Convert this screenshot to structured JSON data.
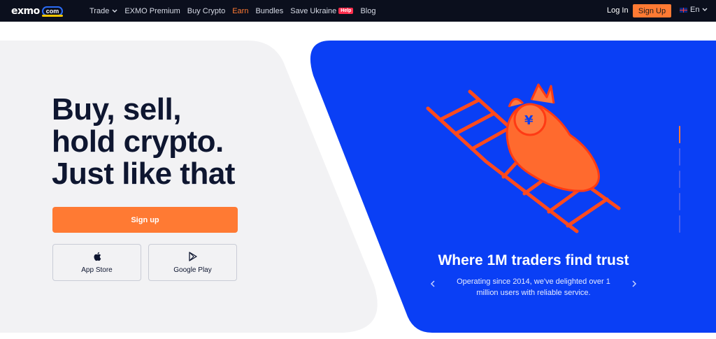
{
  "nav": {
    "logo_text": "exmo",
    "logo_badge": "com",
    "links": [
      {
        "label": "Trade",
        "has_dropdown": true
      },
      {
        "label": "EXMO Premium"
      },
      {
        "label": "Buy Crypto"
      },
      {
        "label": "Earn",
        "highlight": true
      },
      {
        "label": "Bundles"
      },
      {
        "label": "Save Ukraine",
        "badge": "Help"
      },
      {
        "label": "Blog"
      }
    ],
    "login": "Log In",
    "signup": "Sign Up",
    "language": "En"
  },
  "hero": {
    "headline": [
      "Buy, sell,",
      "hold crypto.",
      "Just like that"
    ],
    "signup_button": "Sign up",
    "app_store": {
      "label": "App Store",
      "icon": "apple-icon"
    },
    "google_play": {
      "label": "Google Play",
      "icon": "google-play-icon"
    }
  },
  "slider": {
    "title": "Where 1M traders find trust",
    "description": "Operating since 2014, we've delighted over 1 million users with reliable service.",
    "prev_icon": "chevron-left-icon",
    "next_icon": "chevron-right-icon",
    "indicator_count": 5,
    "active_index": 0
  },
  "colors": {
    "nav_bg": "#0b0f1d",
    "accent_orange": "#ff7a33",
    "hero_blue": "#0a3ff5",
    "left_panel": "#f2f2f4",
    "headline": "#0e1630"
  }
}
